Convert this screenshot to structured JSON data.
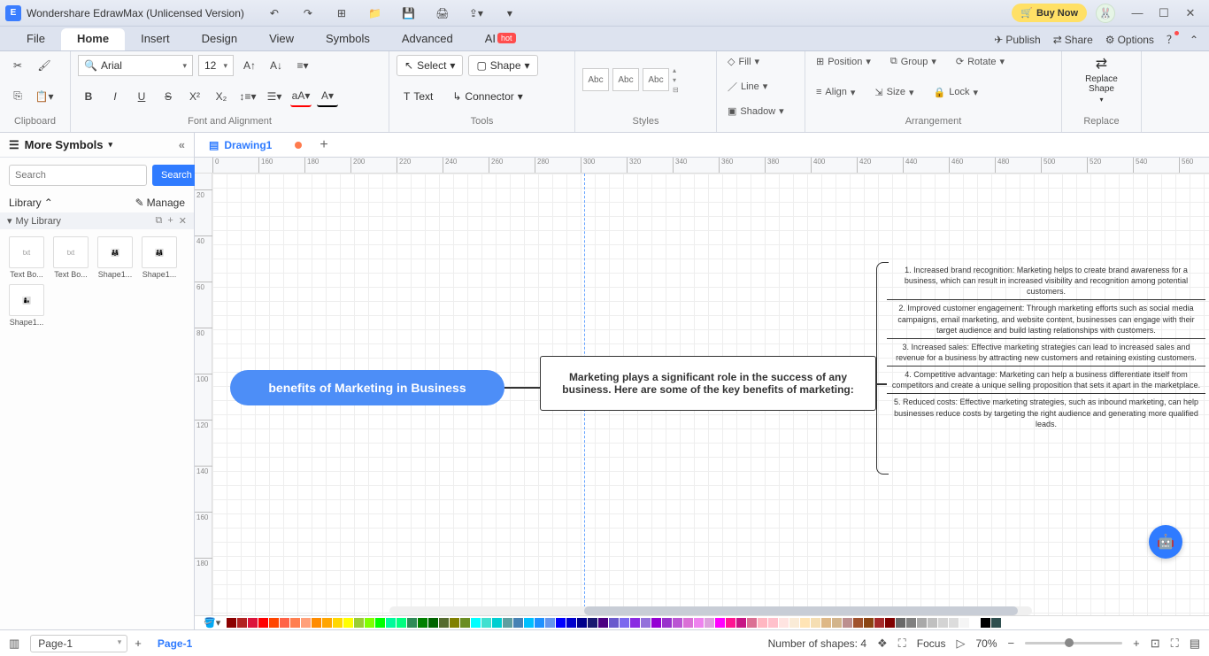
{
  "titlebar": {
    "app_name": "Wondershare EdrawMax (Unlicensed Version)",
    "buy_label": "Buy Now"
  },
  "menu": {
    "tabs": [
      "File",
      "Home",
      "Insert",
      "Design",
      "View",
      "Symbols",
      "Advanced",
      "AI"
    ],
    "active": "Home",
    "publish": "Publish",
    "share": "Share",
    "options": "Options"
  },
  "ribbon": {
    "font_name": "Arial",
    "font_size": "12",
    "select_label": "Select",
    "shape_label": "Shape",
    "text_label": "Text",
    "connector_label": "Connector",
    "fill": "Fill",
    "line": "Line",
    "shadow": "Shadow",
    "position": "Position",
    "align": "Align",
    "group": "Group",
    "size": "Size",
    "rotate": "Rotate",
    "lock": "Lock",
    "replace_shape": "Replace\nShape",
    "groups": {
      "clipboard": "Clipboard",
      "font": "Font and Alignment",
      "tools": "Tools",
      "styles": "Styles",
      "arrangement": "Arrangement",
      "replace": "Replace"
    },
    "style_sample": "Abc"
  },
  "leftpanel": {
    "title": "More Symbols",
    "search_placeholder": "Search",
    "search_btn": "Search",
    "library": "Library",
    "manage": "Manage",
    "mylib": "My Library",
    "items": [
      {
        "label": "Text Bo..."
      },
      {
        "label": "Text Bo..."
      },
      {
        "label": "Shape1..."
      },
      {
        "label": "Shape1..."
      },
      {
        "label": "Shape1..."
      }
    ]
  },
  "document": {
    "tab_name": "Drawing1"
  },
  "ruler_h": [
    "0",
    "160",
    "180",
    "200",
    "220",
    "240",
    "260",
    "280",
    "300",
    "320",
    "340",
    "360",
    "380",
    "400",
    "420",
    "440",
    "460",
    "480",
    "500",
    "520",
    "540",
    "560"
  ],
  "ruler_v": [
    "20",
    "40",
    "60",
    "80",
    "100",
    "120",
    "140",
    "160",
    "180"
  ],
  "diagram": {
    "main": "benefits of Marketing in Business",
    "sub": "Marketing plays a significant role in the success of any business. Here are some of the key benefits of marketing:",
    "benefits": [
      "1. Increased brand recognition: Marketing helps to create brand awareness for a business, which can result in increased visibility and recognition among potential customers.",
      "2. Improved customer engagement: Through marketing efforts such as social media campaigns, email marketing, and website content, businesses can engage with their target audience and build lasting relationships with customers.",
      "3. Increased sales: Effective marketing strategies can lead to increased sales and revenue for a business by attracting new customers and retaining existing customers.",
      "4. Competitive advantage: Marketing can help a business differentiate itself from competitors and create a unique selling proposition that sets it apart in the marketplace.",
      "5. Reduced costs: Effective marketing strategies, such as inbound marketing, can help businesses reduce costs by targeting the right audience and generating more qualified leads."
    ]
  },
  "statusbar": {
    "page_dd": "Page-1",
    "page_tab": "Page-1",
    "shapes": "Number of shapes: 4",
    "focus": "Focus",
    "zoom": "70%"
  },
  "colors": [
    "#8b0000",
    "#b22222",
    "#dc143c",
    "#ff0000",
    "#ff4500",
    "#ff6347",
    "#ff7f50",
    "#ffa07a",
    "#ff8c00",
    "#ffa500",
    "#ffd700",
    "#ffff00",
    "#9acd32",
    "#7fff00",
    "#00ff00",
    "#00fa9a",
    "#00ff7f",
    "#2e8b57",
    "#008000",
    "#006400",
    "#556b2f",
    "#808000",
    "#6b8e23",
    "#00ffff",
    "#40e0d0",
    "#00ced1",
    "#5f9ea0",
    "#4682b4",
    "#00bfff",
    "#1e90ff",
    "#6495ed",
    "#0000ff",
    "#0000cd",
    "#00008b",
    "#191970",
    "#4b0082",
    "#6a5acd",
    "#7b68ee",
    "#8a2be2",
    "#9370db",
    "#9400d3",
    "#9932cc",
    "#ba55d3",
    "#da70d6",
    "#ee82ee",
    "#dda0dd",
    "#ff00ff",
    "#ff1493",
    "#c71585",
    "#db7093",
    "#ffb6c1",
    "#ffc0cb",
    "#ffe4e1",
    "#faebd7",
    "#ffe4b5",
    "#f5deb3",
    "#deb887",
    "#d2b48c",
    "#bc8f8f",
    "#a0522d",
    "#8b4513",
    "#a52a2a",
    "#800000",
    "#696969",
    "#808080",
    "#a9a9a9",
    "#c0c0c0",
    "#d3d3d3",
    "#dcdcdc",
    "#f5f5f5",
    "#ffffff",
    "#000000",
    "#2f4f4f"
  ]
}
